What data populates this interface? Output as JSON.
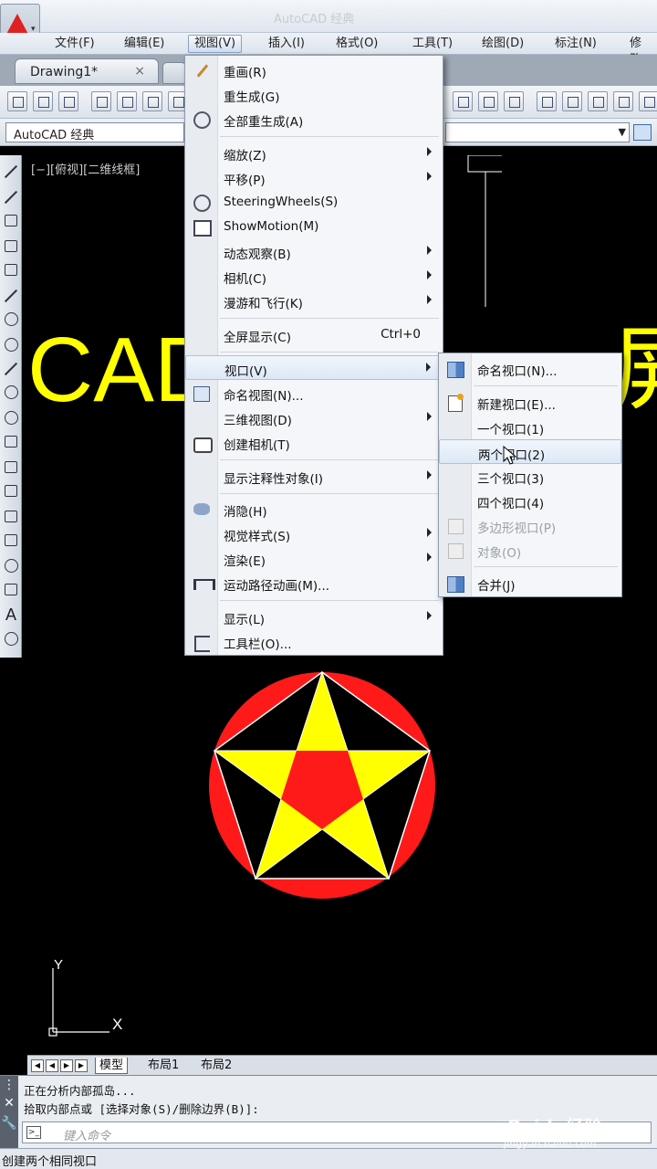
{
  "titlebar": {
    "title": "AutoCAD 经典"
  },
  "menubar": {
    "items": [
      "文件(F)",
      "编辑(E)",
      "视图(V)",
      "插入(I)",
      "格式(O)",
      "工具(T)",
      "绘图(D)",
      "标注(N)",
      "修改"
    ],
    "active": "视图(V)"
  },
  "doc_tab": {
    "label": "Drawing1*",
    "close": "×"
  },
  "workspace": {
    "label": "AutoCAD 经典"
  },
  "canvas": {
    "viewport_label": "[−][俯视][二维线框]",
    "big_text_left": "CAD",
    "big_text_right": "屏",
    "ucs_y": "Y",
    "ucs_x": "X",
    "colors": {
      "yellow": "#ffff00",
      "red": "#ff1a1a",
      "background": "#000000"
    }
  },
  "view_menu": {
    "items": [
      {
        "label": "重画(R)",
        "icon": "pencil-icon"
      },
      {
        "label": "重生成(G)"
      },
      {
        "label": "全部重生成(A)",
        "icon": "regen-all-icon"
      },
      {
        "label": "缩放(Z)",
        "submenu": true
      },
      {
        "label": "平移(P)",
        "submenu": true
      },
      {
        "label": "SteeringWheels(S)",
        "icon": "steering-wheel-icon"
      },
      {
        "label": "ShowMotion(M)",
        "icon": "showmotion-icon"
      },
      {
        "label": "动态观察(B)",
        "submenu": true
      },
      {
        "label": "相机(C)",
        "submenu": true
      },
      {
        "label": "漫游和飞行(K)",
        "submenu": true
      },
      {
        "label": "全屏显示(C)",
        "shortcut": "Ctrl+0"
      },
      {
        "label": "视口(V)",
        "submenu": true
      },
      {
        "label": "命名视图(N)...",
        "icon": "named-view-icon"
      },
      {
        "label": "三维视图(D)",
        "submenu": true
      },
      {
        "label": "创建相机(T)",
        "icon": "camera-icon"
      },
      {
        "label": "显示注释性对象(I)",
        "submenu": true
      },
      {
        "label": "消隐(H)",
        "icon": "hide-icon"
      },
      {
        "label": "视觉样式(S)",
        "submenu": true
      },
      {
        "label": "渲染(E)",
        "submenu": true
      },
      {
        "label": "运动路径动画(M)...",
        "icon": "motion-path-icon"
      },
      {
        "label": "显示(L)",
        "submenu": true
      },
      {
        "label": "工具栏(O)...",
        "icon": "toolbar-icon"
      }
    ]
  },
  "viewport_submenu": {
    "items": [
      {
        "label": "命名视口(N)...",
        "icon": "named-viewport-icon"
      },
      {
        "label": "新建视口(E)...",
        "icon": "new-viewport-icon"
      },
      {
        "label": "一个视口(1)"
      },
      {
        "label": "两个视口(2)",
        "highlighted": true
      },
      {
        "label": "三个视口(3)"
      },
      {
        "label": "四个视口(4)"
      },
      {
        "label": "多边形视口(P)",
        "disabled": true,
        "icon": "polygon-viewport-icon"
      },
      {
        "label": "对象(O)",
        "disabled": true,
        "icon": "object-viewport-icon"
      },
      {
        "label": "合并(J)",
        "icon": "join-viewport-icon"
      }
    ]
  },
  "layout_tabs": {
    "model": "模型",
    "layout1": "布局1",
    "layout2": "布局2"
  },
  "command": {
    "line1": "正在分析内部孤岛...",
    "line2": "拾取内部点或 [选择对象(S)/删除边界(B)]:",
    "placeholder": "键入命令"
  },
  "status": {
    "text": "创建两个相同视口"
  },
  "watermark": {
    "brand": "Baidu经验",
    "url": "jingyan.baidu.com"
  }
}
